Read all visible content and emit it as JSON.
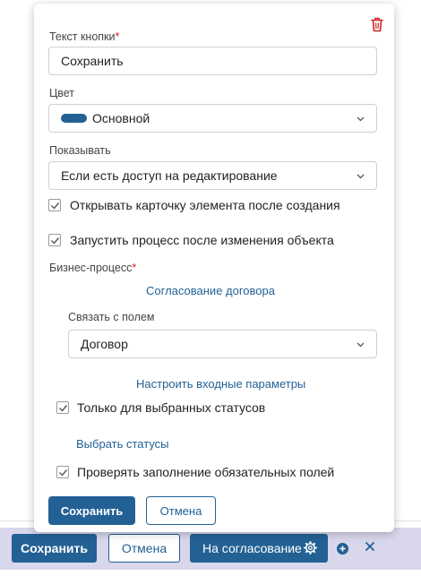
{
  "colors": {
    "accent": "#236195",
    "danger": "#d22222",
    "bottom_bar_bg": "#d9d7ec"
  },
  "panel": {
    "button_text": {
      "label": "Текст кнопки",
      "required_mark": "*",
      "value": "Сохранить"
    },
    "color": {
      "label": "Цвет",
      "value": "Основной",
      "swatch_color": "#236195"
    },
    "show": {
      "label": "Показывать",
      "value": "Если есть доступ на редактирование"
    },
    "open_card": {
      "label": "Открывать карточку элемента после создания",
      "checked": true
    },
    "run_process": {
      "label": "Запустить процесс после изменения объекта",
      "checked": true
    },
    "business_process": {
      "label": "Бизнес-процесс",
      "required_mark": "*",
      "link": "Согласование договора"
    },
    "link_field": {
      "label": "Связать с полем",
      "value": "Договор"
    },
    "configure_params_link": "Настроить входные параметры",
    "only_selected_statuses": {
      "label": "Только для выбранных статусов",
      "checked": true
    },
    "select_statuses_link": "Выбрать статусы",
    "check_required": {
      "label": "Проверять заполнение обязательных полей",
      "checked": true
    },
    "save_label": "Сохранить",
    "cancel_label": "Отмена"
  },
  "bottom_bar": {
    "save_label": "Сохранить",
    "cancel_label": "Отмена",
    "approve_label": "На согласование"
  }
}
